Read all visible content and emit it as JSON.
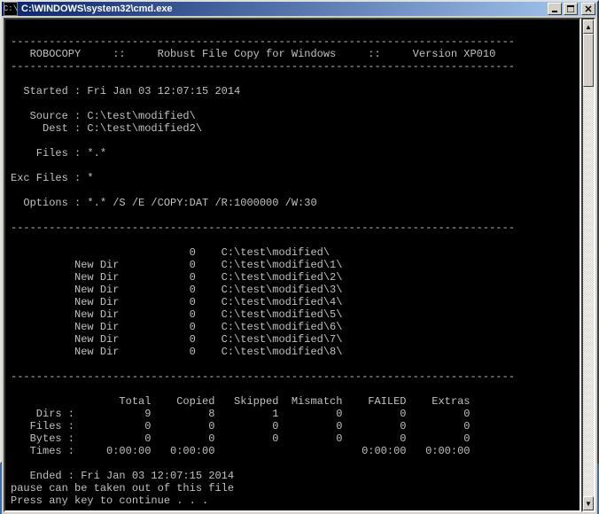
{
  "window": {
    "title": "C:\\WINDOWS\\system32\\cmd.exe",
    "icon_glyph": "C:\\"
  },
  "hr": "-------------------------------------------------------------------------------",
  "header": {
    "name": "ROBOCOPY",
    "sep": "::",
    "desc": "Robust File Copy for Windows",
    "version": "Version XP010"
  },
  "info": {
    "started_label": "Started :",
    "started_value": "Fri Jan 03 12:07:15 2014",
    "source_label": "Source :",
    "source_value": "C:\\test\\modified\\",
    "dest_label": "Dest :",
    "dest_value": "C:\\test\\modified2\\",
    "files_label": "Files :",
    "files_value": "*.*",
    "exc_label": "Exc Files :",
    "exc_value": "*",
    "options_label": "Options :",
    "options_value": "*.* /S /E /COPY:DAT /R:1000000 /W:30"
  },
  "dirs": [
    {
      "tag": "       ",
      "count": "0",
      "path": "C:\\test\\modified\\"
    },
    {
      "tag": "New Dir",
      "count": "0",
      "path": "C:\\test\\modified\\1\\"
    },
    {
      "tag": "New Dir",
      "count": "0",
      "path": "C:\\test\\modified\\2\\"
    },
    {
      "tag": "New Dir",
      "count": "0",
      "path": "C:\\test\\modified\\3\\"
    },
    {
      "tag": "New Dir",
      "count": "0",
      "path": "C:\\test\\modified\\4\\"
    },
    {
      "tag": "New Dir",
      "count": "0",
      "path": "C:\\test\\modified\\5\\"
    },
    {
      "tag": "New Dir",
      "count": "0",
      "path": "C:\\test\\modified\\6\\"
    },
    {
      "tag": "New Dir",
      "count": "0",
      "path": "C:\\test\\modified\\7\\"
    },
    {
      "tag": "New Dir",
      "count": "0",
      "path": "C:\\test\\modified\\8\\"
    }
  ],
  "summary": {
    "headers": [
      "Total",
      "Copied",
      "Skipped",
      "Mismatch",
      "FAILED",
      "Extras"
    ],
    "rows": [
      {
        "label": "Dirs :",
        "vals": [
          "9",
          "8",
          "1",
          "0",
          "0",
          "0"
        ]
      },
      {
        "label": "Files :",
        "vals": [
          "0",
          "0",
          "0",
          "0",
          "0",
          "0"
        ]
      },
      {
        "label": "Bytes :",
        "vals": [
          "0",
          "0",
          "0",
          "0",
          "0",
          "0"
        ]
      },
      {
        "label": "Times :",
        "vals": [
          "0:00:00",
          "0:00:00",
          "",
          "",
          "0:00:00",
          "0:00:00"
        ]
      }
    ]
  },
  "footer": {
    "ended_label": "Ended :",
    "ended_value": "Fri Jan 03 12:07:15 2014",
    "note": "pause can be taken out of this file",
    "prompt": "Press any key to continue . . ."
  }
}
